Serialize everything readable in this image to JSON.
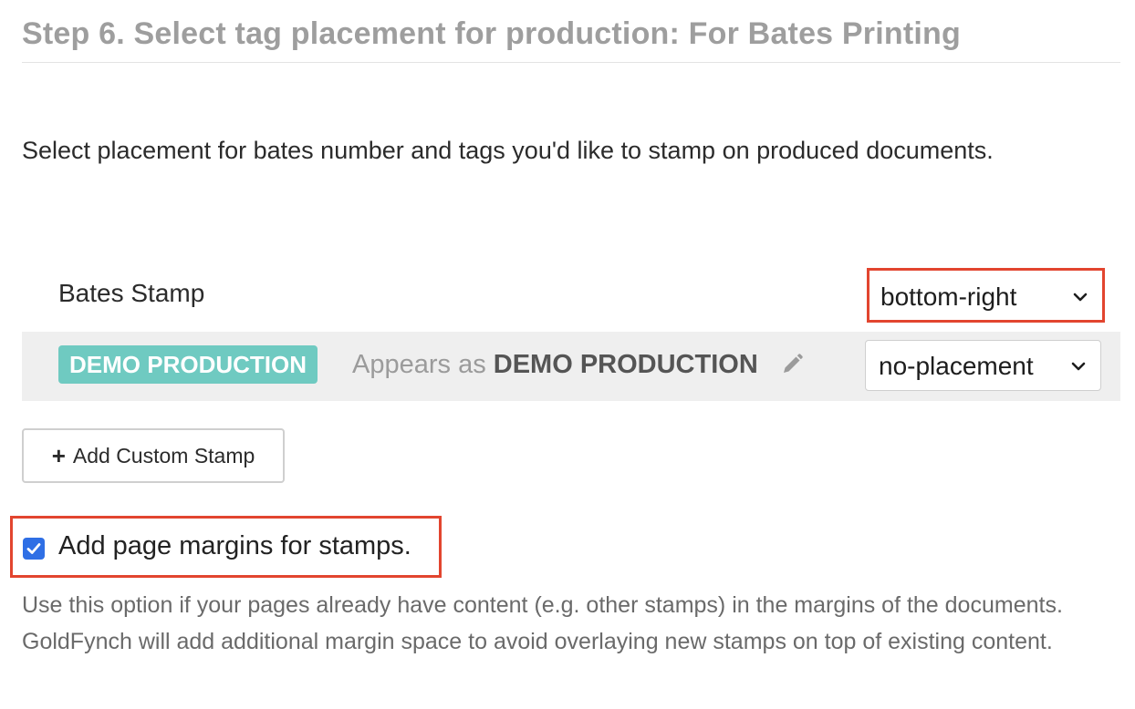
{
  "step": {
    "title": "Step 6. Select tag placement for production: For Bates Printing"
  },
  "intro_text": "Select placement for bates number and tags you'd like to stamp on produced documents.",
  "stamps": {
    "bates": {
      "label": "Bates Stamp",
      "placement": "bottom-right"
    },
    "tag": {
      "badge": "DEMO PRODUCTION",
      "appears_prefix": "Appears as",
      "appears_name": "DEMO PRODUCTION",
      "placement": "no-placement",
      "edit_icon": "pencil-icon"
    }
  },
  "add_custom_stamp": {
    "icon": "plus-icon",
    "label": "Add Custom Stamp"
  },
  "margins_option": {
    "checked": true,
    "label": "Add page margins for stamps.",
    "help": "Use this option if your pages already have content (e.g. other stamps) in the margins of the documents. GoldFynch will add additional margin space to avoid overlaying new stamps on top of existing content."
  },
  "colors": {
    "highlight": "#e2452f",
    "tag_badge": "#6fcac1",
    "checkbox": "#2f6fe5"
  }
}
